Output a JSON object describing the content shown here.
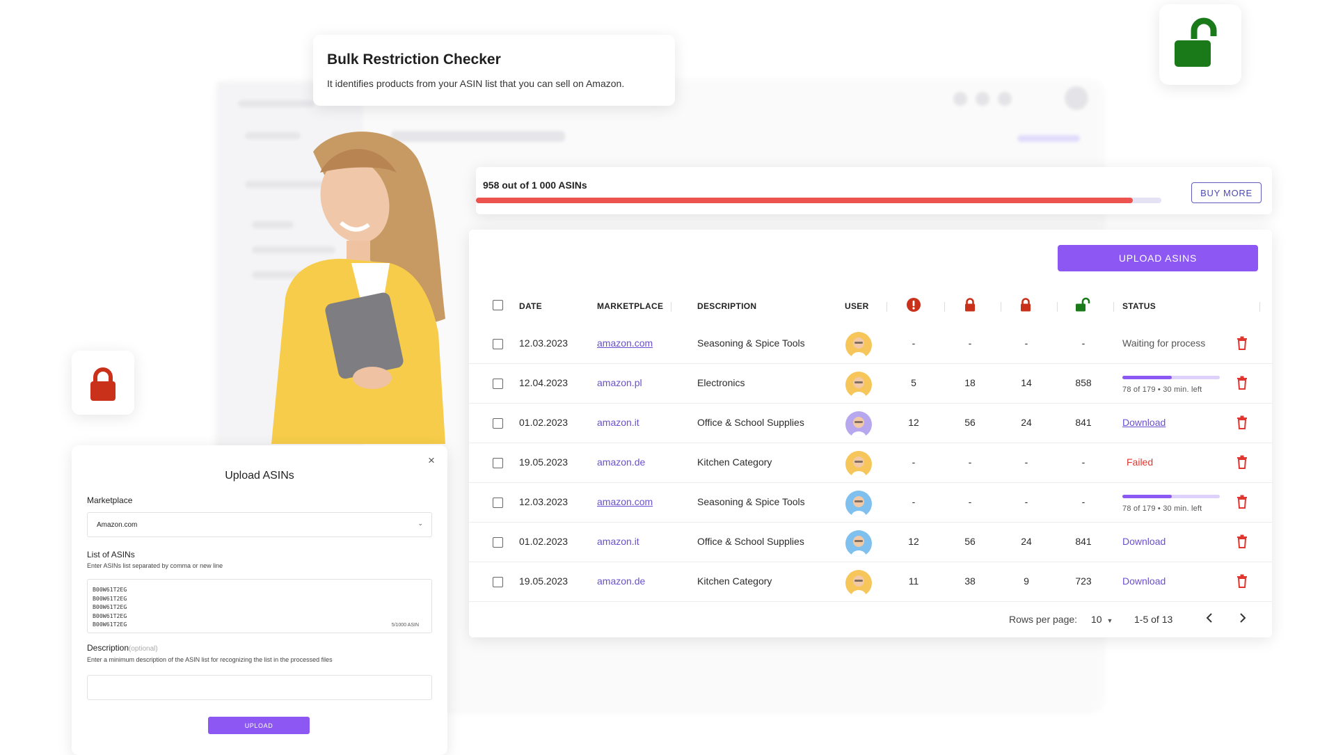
{
  "title_card": {
    "title": "Bulk Restriction Checker",
    "subtitle": "It identifies products from your ASIN list that you can sell on Amazon."
  },
  "quota": {
    "text": "958 out of 1 000 ASINs",
    "used": 958,
    "total": 1000,
    "buy_more_label": "BUY MORE"
  },
  "table": {
    "upload_button_label": "UPLOAD ASINS",
    "headers": {
      "date": "DATE",
      "marketplace": "MARKETPLACE",
      "description": "DESCRIPTION",
      "user": "USER",
      "status": "STATUS"
    },
    "header_icons": [
      "warning-icon",
      "lock-red-icon",
      "lock-red-icon",
      "unlock-green-icon"
    ],
    "rows": [
      {
        "date": "12.03.2023",
        "marketplace": "amazon.com",
        "description": "Seasoning & Spice Tools",
        "c1": "-",
        "c2": "-",
        "c3": "-",
        "c4": "-",
        "status_type": "text",
        "status": "Waiting for process"
      },
      {
        "date": "12.04.2023",
        "marketplace": "amazon.pl",
        "description": "Electronics",
        "c1": "5",
        "c2": "18",
        "c3": "14",
        "c4": "858",
        "status_type": "progress",
        "status": "78 of 179 • 30 min. left",
        "progress": 0.51
      },
      {
        "date": "01.02.2023",
        "marketplace": "amazon.it",
        "description": "Office & School Supplies",
        "c1": "12",
        "c2": "56",
        "c3": "24",
        "c4": "841",
        "status_type": "download",
        "status": "Download"
      },
      {
        "date": "19.05.2023",
        "marketplace": "amazon.de",
        "description": "Kitchen Category",
        "c1": "-",
        "c2": "-",
        "c3": "-",
        "c4": "-",
        "status_type": "failed",
        "status": "Failed"
      },
      {
        "date": "12.03.2023",
        "marketplace": "amazon.com",
        "description": "Seasoning & Spice Tools",
        "c1": "-",
        "c2": "-",
        "c3": "-",
        "c4": "-",
        "status_type": "progress",
        "status": "78 of 179 • 30 min. left",
        "progress": 0.51
      },
      {
        "date": "01.02.2023",
        "marketplace": "amazon.it",
        "description": "Office & School Supplies",
        "c1": "12",
        "c2": "56",
        "c3": "24",
        "c4": "841",
        "status_type": "download",
        "status": "Download"
      },
      {
        "date": "19.05.2023",
        "marketplace": "amazon.de",
        "description": "Kitchen Category",
        "c1": "11",
        "c2": "38",
        "c3": "9",
        "c4": "723",
        "status_type": "download",
        "status": "Download"
      }
    ],
    "pager": {
      "rows_per_page_label": "Rows per page:",
      "rows_per_page_value": "10",
      "range": "1-5 of 13"
    }
  },
  "upload_modal": {
    "title": "Upload ASINs",
    "close_symbol": "×",
    "marketplace_label": "Marketplace",
    "marketplace_value": "Amazon.com",
    "asins_label": "List of ASINs",
    "asins_hint": "Enter ASINs list separated by comma or new line",
    "asins_value": "B00W61T2EG\nB00W61T2EG\nB00W61T2EG\nB00W61T2EG\nB00W61T2EG",
    "asins_count": "5/1000 ASIN",
    "description_label": "Description",
    "description_optional": "(optional)",
    "description_hint": "Enter a minimum description of the ASIN list for recognizing the list in the processed files",
    "upload_label": "UPLOAD"
  },
  "colors": {
    "accent": "#8c57f2",
    "link": "#6a4fd0",
    "danger": "#e0362f",
    "lock_red": "#c9311b",
    "unlock_green": "#1a7a1a",
    "quota_bar": "#ec524e"
  }
}
